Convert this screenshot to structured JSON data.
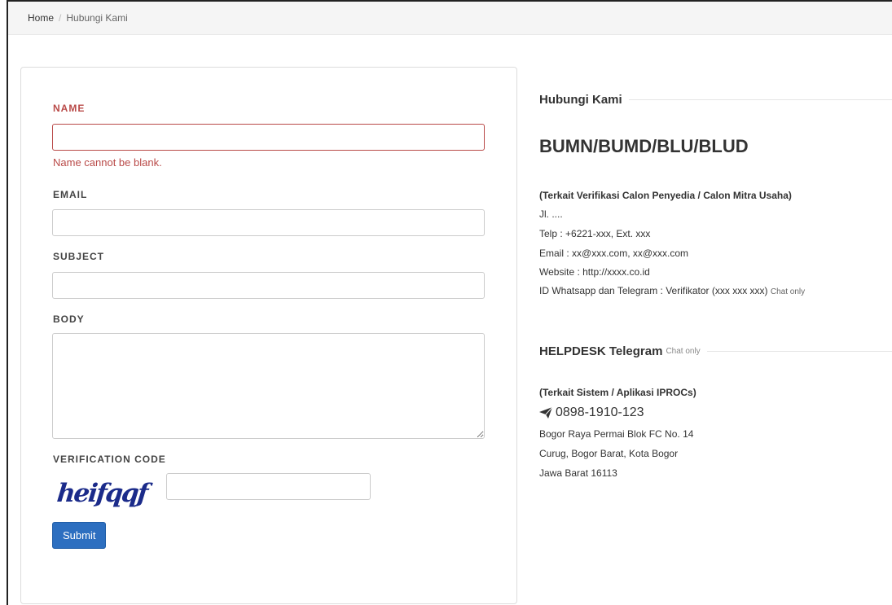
{
  "breadcrumb": {
    "home": "Home",
    "separator": "/",
    "current": "Hubungi Kami"
  },
  "form": {
    "name_label": "NAME",
    "name_value": "",
    "name_error": "Name cannot be blank.",
    "email_label": "EMAIL",
    "email_value": "",
    "subject_label": "SUBJECT",
    "subject_value": "",
    "body_label": "BODY",
    "body_value": "",
    "verification_label": "VERIFICATION CODE",
    "captcha_text": "heifqqf",
    "verification_value": "",
    "submit_label": "Submit",
    "error_color": "#b94a48",
    "button_color": "#2d6fc0"
  },
  "contact": {
    "heading": "Hubungi Kami",
    "org_title": "BUMN/BUMD/BLU/BLUD",
    "verification_subtitle": "(Terkait Verifikasi Calon Penyedia / Calon Mitra Usaha)",
    "address": "Jl. ....",
    "phone": "Telp : +6221-xxx, Ext. xxx",
    "email": "Email : xx@xxx.com, xx@xxx.com",
    "website": "Website : http://xxxx.co.id",
    "messaging": "ID Whatsapp dan Telegram : Verifikator (xxx xxx xxx)",
    "messaging_note": "Chat only"
  },
  "helpdesk": {
    "heading": "HELPDESK Telegram",
    "heading_note": "Chat only",
    "subtitle": "(Terkait Sistem / Aplikasi IPROCs)",
    "telegram_icon": "telegram-send-icon",
    "phone": "0898-1910-123",
    "address_line1": "Bogor Raya Permai Blok FC No. 14",
    "address_line2": "Curug, Bogor Barat, Kota Bogor",
    "address_line3": "Jawa Barat 16113"
  }
}
